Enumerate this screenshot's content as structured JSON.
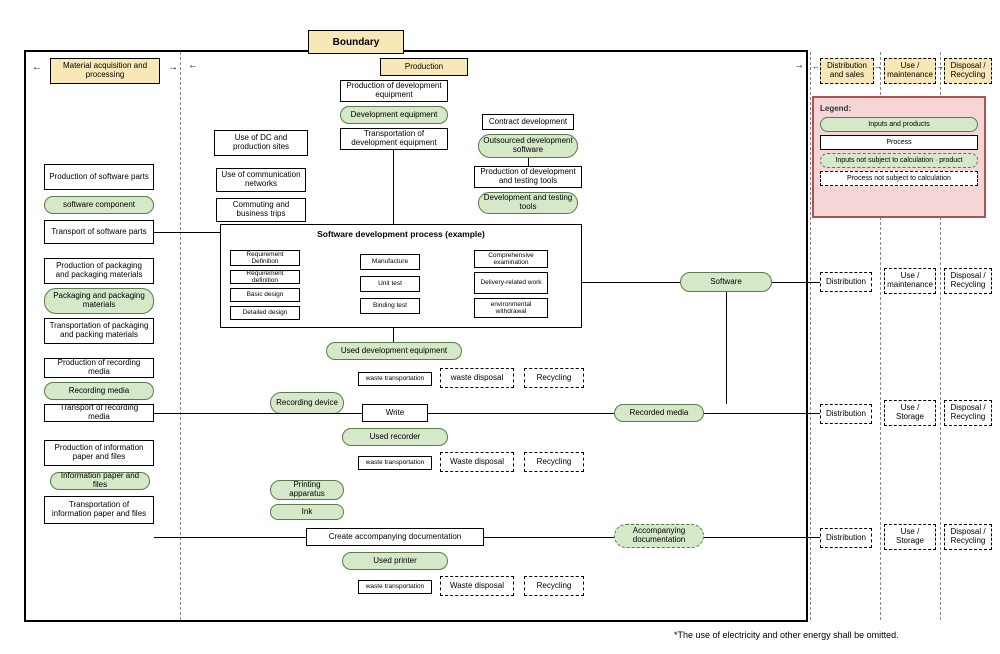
{
  "headers": {
    "boundary": "Boundary",
    "material": "Material acquisition and processing",
    "production": "Production",
    "distribution": "Distribution and sales",
    "use": "Use / maintenance",
    "disposal": "Disposal / Recycling"
  },
  "left": {
    "p1": "Production of software parts",
    "i1": "software component",
    "p2": "Transport of software parts",
    "p3": "Production of packaging and packaging materials",
    "i3": "Packaging and packaging materials",
    "p4": "Transportation of packaging and packing materials",
    "p5": "Production of recording media",
    "i5": "Recording media",
    "p6": "Transport of recording media",
    "p7": "Production of information paper and files",
    "i7": "Information paper and files",
    "p8": "Transportation of information paper and files"
  },
  "top": {
    "p_devequip_prod": "Production of development equipment",
    "i_devequip": "Development equipment",
    "p_transport_dev": "Transportation of development equipment",
    "p_dc": "Use of DC and production sites",
    "p_comm": "Use of communication networks",
    "p_commute": "Commuting and business trips",
    "p_contract": "Contract development",
    "i_outsourced": "Outsourced development software",
    "p_tools_prod": "Production of development and testing tools",
    "i_tools": "Development and testing tools"
  },
  "dev": {
    "title": "Software development process (example)",
    "c1a": "Requirement Definition",
    "c1b": "Requirement definition",
    "c1c": "Basic design",
    "c1d": "Detailed design",
    "c2a": "Manufacture",
    "c2b": "Unit test",
    "c2c": "Binding test",
    "c3a": "Comprehensive examination",
    "c3b": "Delivery-related work",
    "c3c": "environmental withdrawal"
  },
  "mid": {
    "software": "Software",
    "used_dev": "Used development equipment",
    "waste_trans": "waste transportation",
    "waste_disp": "waste disposal",
    "waste_disp2": "Waste disposal",
    "recycle": "Recycling",
    "rec_device": "Recording device",
    "write": "Write",
    "recorded": "Recorded media",
    "used_rec": "Used recorder",
    "print_app": "Printing apparatus",
    "ink": "Ink",
    "create_doc": "Create accompanying documentation",
    "accomp_doc": "Accompanying documentation",
    "used_printer": "Used printer"
  },
  "right_rows": {
    "r1": {
      "dist": "Distribution",
      "use": "Use / maintenance",
      "disp": "Disposal / Recycling"
    },
    "r2": {
      "dist": "Distribution",
      "use": "Use / Storage",
      "disp": "Disposal / Recycling"
    },
    "r3": {
      "dist": "Distribution",
      "use": "Use / Storage",
      "disp": "Disposal / Recycling"
    }
  },
  "legend": {
    "title": "Legend:",
    "l1": "Inputs and products",
    "l2": "Process",
    "l3": "Inputs not subject to calculation · product",
    "l4": "Process not subject to calculation"
  },
  "footnote": "*The use of electricity and other energy shall be omitted."
}
